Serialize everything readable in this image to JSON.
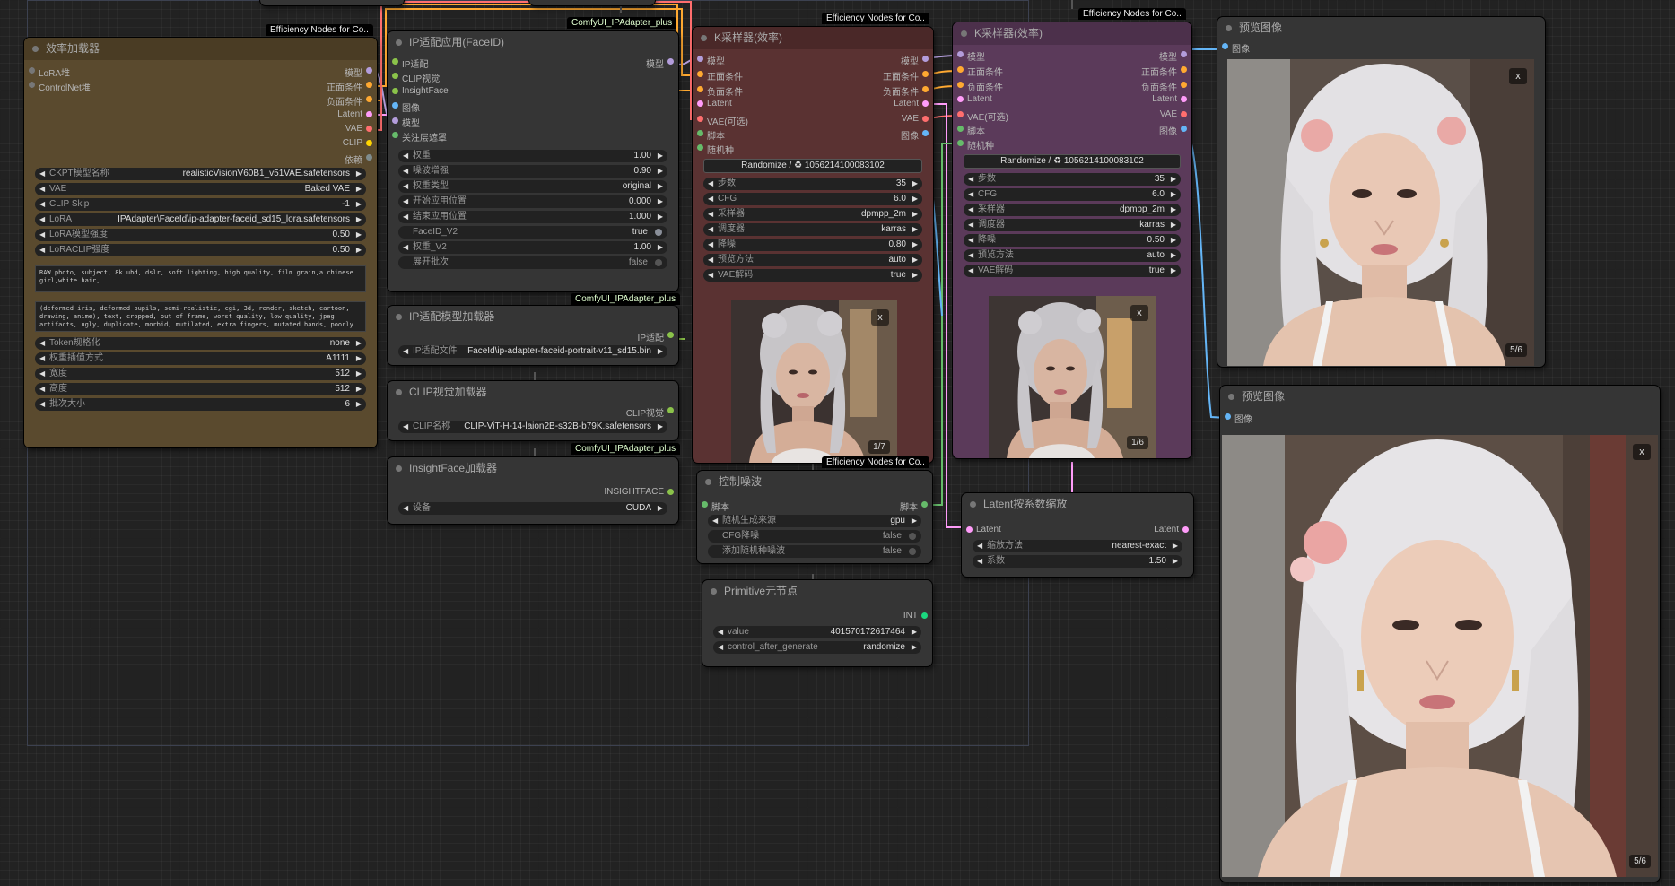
{
  "colors": {
    "model": "#b39ddb",
    "conditioning": "#ffa931",
    "latent": "#ff9cf9",
    "vae": "#ff6e6e",
    "clip": "#ffd500",
    "image": "#64b5f6",
    "script": "#66bb6a",
    "dependencies": "#7f8c8d",
    "ipadapter": "#8bc34a",
    "int": "#1bd87f"
  },
  "badges": {
    "efficiency": "Efficiency Nodes for Co..",
    "ipadapter_plus": "ComfyUI_IPAdapter_plus"
  },
  "loader": {
    "title": "效率加载器",
    "inputs": [
      "LoRA堆",
      "ControlNet堆"
    ],
    "outputs": [
      "模型",
      "正面条件",
      "负面条件",
      "Latent",
      "VAE",
      "CLIP",
      "依赖"
    ],
    "widgets": [
      {
        "label": "CKPT模型名称",
        "value": "realisticVisionV60B1_v51VAE.safetensors"
      },
      {
        "label": "VAE",
        "value": "Baked VAE"
      },
      {
        "label": "CLIP Skip",
        "value": "-1"
      },
      {
        "label": "LoRA",
        "value": "IPAdapter\\FaceId\\ip-adapter-faceid_sd15_lora.safetensors"
      },
      {
        "label": "LoRA模型强度",
        "value": "0.50"
      },
      {
        "label": "LoRACLIP强度",
        "value": "0.50"
      }
    ],
    "positive_prompt": "RAW photo, subject, 8k uhd, dslr, soft lighting, high quality, film grain,a chinese girl,white hair,",
    "negative_prompt": "(deformed iris, deformed pupils, semi-realistic, cgi, 3d, render, sketch, cartoon, drawing, anime), text, cropped, out of frame, worst quality, low quality, jpeg artifacts, ugly, duplicate, morbid, mutilated, extra fingers, mutated hands, poorly",
    "widgets2": [
      {
        "label": "Token规格化",
        "value": "none"
      },
      {
        "label": "权重插值方式",
        "value": "A1111"
      },
      {
        "label": "宽度",
        "value": "512"
      },
      {
        "label": "高度",
        "value": "512"
      },
      {
        "label": "批次大小",
        "value": "6"
      }
    ]
  },
  "ipapply": {
    "title": "IP适配应用(FaceID)",
    "inputs": [
      "IP适配",
      "CLIP视觉",
      "InsightFace",
      "图像",
      "模型",
      "关注层遮罩"
    ],
    "output": "模型",
    "widgets": [
      {
        "label": "权重",
        "value": "1.00"
      },
      {
        "label": "噪波增强",
        "value": "0.90"
      },
      {
        "label": "权重类型",
        "value": "original"
      },
      {
        "label": "开始应用位置",
        "value": "0.000"
      },
      {
        "label": "结束应用位置",
        "value": "1.000"
      }
    ],
    "toggle1": {
      "label": "FaceID_V2",
      "value": "true"
    },
    "widget_v2": {
      "label": "权重_V2",
      "value": "1.00"
    },
    "toggle2": {
      "label": "展开批次",
      "value": "false"
    }
  },
  "iploader": {
    "title": "IP适配模型加载器",
    "output": "IP适配",
    "widget": {
      "label": "IP适配文件",
      "value": "FaceId\\ip-adapter-faceid-portrait-v11_sd15.bin"
    }
  },
  "clipvision": {
    "title": "CLIP视觉加载器",
    "output": "CLIP视觉",
    "widget": {
      "label": "CLIP名称",
      "value": "CLIP-ViT-H-14-laion2B-s32B-b79K.safetensors"
    }
  },
  "insightface": {
    "title": "InsightFace加载器",
    "output": "INSIGHTFACE",
    "widget": {
      "label": "设备",
      "value": "CUDA"
    }
  },
  "ksampler1": {
    "title": "K采样器(效率)",
    "inputs": [
      "模型",
      "正面条件",
      "负面条件",
      "Latent",
      "VAE(可选)",
      "脚本",
      "随机种"
    ],
    "outputs": [
      "模型",
      "正面条件",
      "负面条件",
      "Latent",
      "VAE",
      "图像"
    ],
    "seed_button": "Randomize / ♻ 1056214100083102",
    "widgets": [
      {
        "label": "步数",
        "value": "35"
      },
      {
        "label": "CFG",
        "value": "6.0"
      },
      {
        "label": "采样器",
        "value": "dpmpp_2m"
      },
      {
        "label": "调度器",
        "value": "karras"
      },
      {
        "label": "降噪",
        "value": "0.80"
      },
      {
        "label": "预览方法",
        "value": "auto"
      },
      {
        "label": "VAE解码",
        "value": "true"
      }
    ],
    "close": "x",
    "counter": "1/7"
  },
  "ksampler2": {
    "title": "K采样器(效率)",
    "inputs": [
      "模型",
      "正面条件",
      "负面条件",
      "Latent",
      "VAE(可选)",
      "脚本",
      "随机种"
    ],
    "outputs": [
      "模型",
      "正面条件",
      "负面条件",
      "Latent",
      "VAE",
      "图像"
    ],
    "seed_button": "Randomize / ♻ 1056214100083102",
    "widgets": [
      {
        "label": "步数",
        "value": "35"
      },
      {
        "label": "CFG",
        "value": "6.0"
      },
      {
        "label": "采样器",
        "value": "dpmpp_2m"
      },
      {
        "label": "调度器",
        "value": "karras"
      },
      {
        "label": "降噪",
        "value": "0.50"
      },
      {
        "label": "预览方法",
        "value": "auto"
      },
      {
        "label": "VAE解码",
        "value": "true"
      }
    ],
    "close": "x",
    "counter": "1/6"
  },
  "noise": {
    "title": "控制噪波",
    "input": "脚本",
    "output": "脚本",
    "widget": {
      "label": "随机生成来源",
      "value": "gpu"
    },
    "toggle1": {
      "label": "CFG降噪",
      "value": "false"
    },
    "toggle2": {
      "label": "添加随机种噪波",
      "value": "false"
    }
  },
  "primitive": {
    "title": "Primitive元节点",
    "output": "INT",
    "widgets": [
      {
        "label": "value",
        "value": "401570172617464"
      },
      {
        "label": "control_after_generate",
        "value": "randomize"
      }
    ]
  },
  "latentscale": {
    "title": "Latent按系数缩放",
    "input": "Latent",
    "output": "Latent",
    "widgets": [
      {
        "label": "缩放方法",
        "value": "nearest-exact"
      },
      {
        "label": "系数",
        "value": "1.50"
      }
    ]
  },
  "preview1": {
    "title": "预览图像",
    "input": "图像",
    "close": "x",
    "counter": "5/6"
  },
  "preview2": {
    "title": "预览图像",
    "input": "图像",
    "close": "x",
    "counter": "5/6"
  }
}
